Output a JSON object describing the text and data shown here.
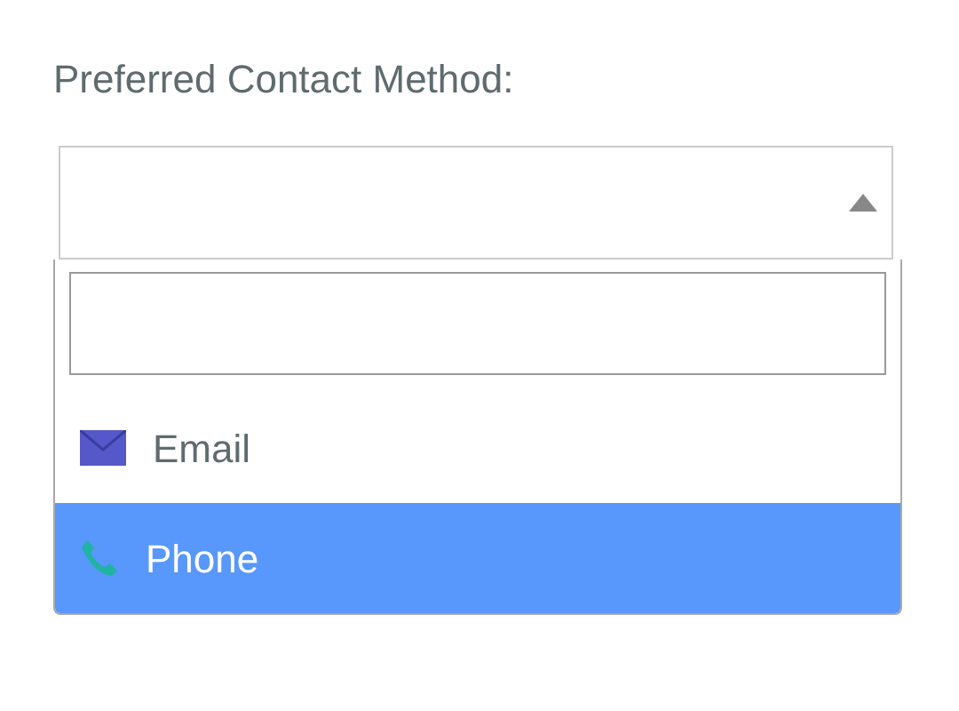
{
  "field_label": "Preferred Contact Method:",
  "select": {
    "expanded": true
  },
  "options": [
    {
      "label": "Email",
      "kind": "email",
      "selected": false
    },
    {
      "label": "Phone",
      "kind": "phone",
      "selected": true
    }
  ]
}
